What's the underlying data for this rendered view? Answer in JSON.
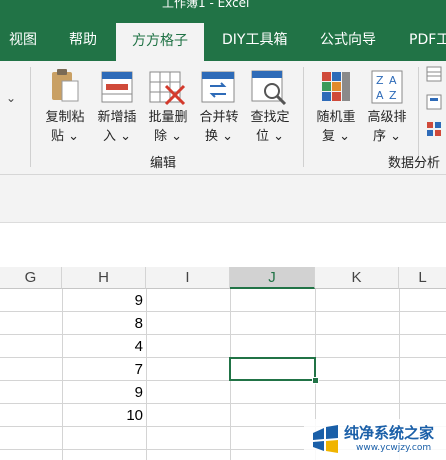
{
  "window": {
    "title": "工作簿1 - Excel"
  },
  "tabs": [
    {
      "label": "视图",
      "active": false
    },
    {
      "label": "帮助",
      "active": false
    },
    {
      "label": "方方格子",
      "active": true
    },
    {
      "label": "DIY工具箱",
      "active": false
    },
    {
      "label": "公式向导",
      "active": false
    },
    {
      "label": "PDF工",
      "active": false
    }
  ],
  "ribbon": {
    "collapsed_arrow": "⌄",
    "buttons": [
      {
        "line1": "复制粘",
        "line2": "贴 ⌄",
        "icon": "clipboard-icon"
      },
      {
        "line1": "新增插",
        "line2": "入 ⌄",
        "icon": "insert-rows-icon"
      },
      {
        "line1": "批量删",
        "line2": "除 ⌄",
        "icon": "batch-delete-icon"
      },
      {
        "line1": "合并转",
        "line2": "换 ⌄",
        "icon": "merge-convert-icon"
      },
      {
        "line1": "查找定",
        "line2": "位 ⌄",
        "icon": "find-locate-icon"
      },
      {
        "line1": "随机重",
        "line2": "复 ⌄",
        "icon": "random-repeat-icon"
      },
      {
        "line1": "高级排",
        "line2": "序 ⌄",
        "icon": "advanced-sort-icon"
      }
    ],
    "groups": {
      "edit": "编辑",
      "analysis": "数据分析"
    }
  },
  "sheet": {
    "columns": [
      "G",
      "H",
      "I",
      "J",
      "K",
      "L"
    ],
    "selected_column": "J",
    "h_values": [
      "9",
      "8",
      "4",
      "7",
      "9",
      "10"
    ]
  },
  "watermark": {
    "text": "纯净系统之家",
    "url": "www.ycwjzy.com"
  },
  "colors": {
    "excel_green": "#217346",
    "ribbon_bg": "#f3f3f3"
  }
}
